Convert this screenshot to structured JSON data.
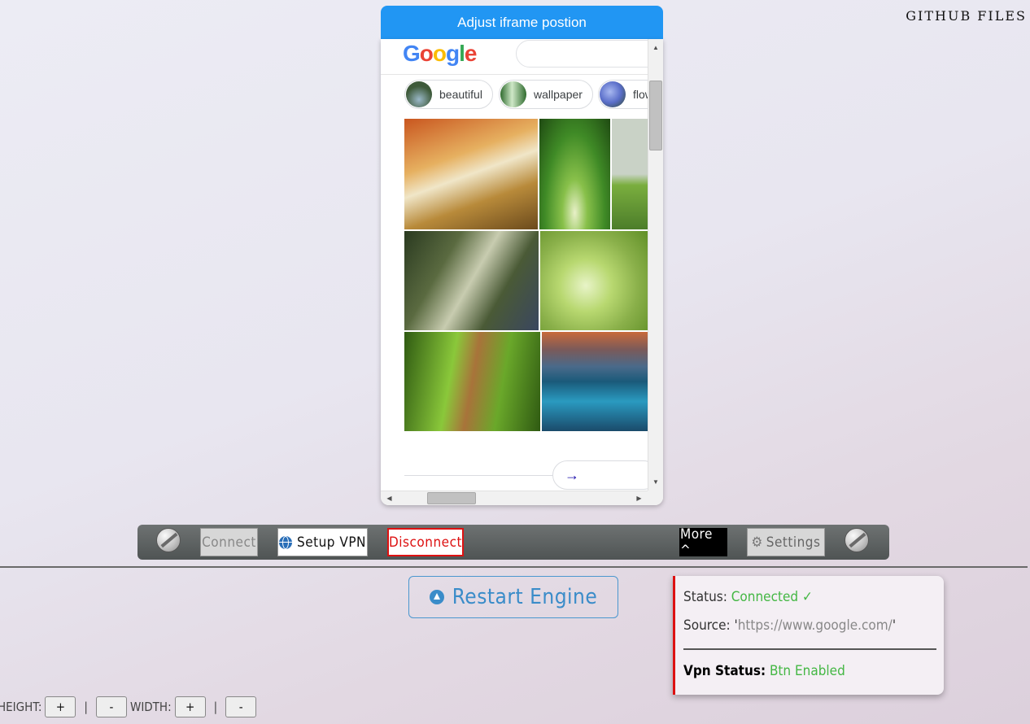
{
  "header": {
    "github_link": "GITHUB FILES",
    "adjust_button": "Adjust iframe postion"
  },
  "iframe": {
    "logo": {
      "letters": [
        "G",
        "o",
        "o",
        "g",
        "l",
        "e"
      ],
      "colors": [
        "#4285f4",
        "#ea4335",
        "#fbbc05",
        "#4285f4",
        "#34a853",
        "#ea4335"
      ]
    },
    "chips": [
      {
        "label": "beautiful",
        "thumb_color": "#3e5a3a"
      },
      {
        "label": "wallpaper",
        "thumb_color": "#2f6b2e"
      },
      {
        "label": "flow",
        "thumb_color": "#5a6ec9"
      }
    ],
    "images": [
      {
        "desc": "autumn-forest-path",
        "colors": [
          "#c9561f",
          "#e0a450",
          "#6b7a3a"
        ]
      },
      {
        "desc": "green-tree-tunnel",
        "colors": [
          "#3f8a26",
          "#88c04a",
          "#2f5e1e"
        ]
      },
      {
        "desc": "green-field",
        "colors": [
          "#c9d2c6",
          "#6fa33a",
          "#4c7d2a"
        ]
      },
      {
        "desc": "misty-forest-road",
        "colors": [
          "#3a4a2c",
          "#9aa58a",
          "#4a5670"
        ]
      },
      {
        "desc": "water-drops-leaf",
        "colors": [
          "#a6c85a",
          "#d8e8a8",
          "#6a9a2a"
        ]
      },
      {
        "desc": "green-woodland-path",
        "colors": [
          "#4a7a1c",
          "#9ac83a",
          "#a8733a"
        ]
      },
      {
        "desc": "mountain-lake",
        "colors": [
          "#d86a3a",
          "#2a8ab0",
          "#1a4a6a"
        ]
      }
    ],
    "next_arrow": "→"
  },
  "toolbar": {
    "connect": "Connect",
    "setup_vpn": "Setup VPN",
    "disconnect": "Disconnect",
    "more": "More ^",
    "settings": "Settings"
  },
  "restart": {
    "label": "Restart Engine"
  },
  "status_panel": {
    "status_label": "Status:",
    "status_value": "Connected",
    "status_check": "✓",
    "source_label": "Source:",
    "source_quote_open": "'",
    "source_value": "https://www.google.com/",
    "source_quote_close": "'",
    "vpn_label": "Vpn Status:",
    "vpn_value": "Btn Enabled"
  },
  "sizer": {
    "height_label": "HEIGHT:",
    "width_label": "WIDTH:",
    "plus": "+",
    "minus": "-",
    "separator": "|"
  }
}
